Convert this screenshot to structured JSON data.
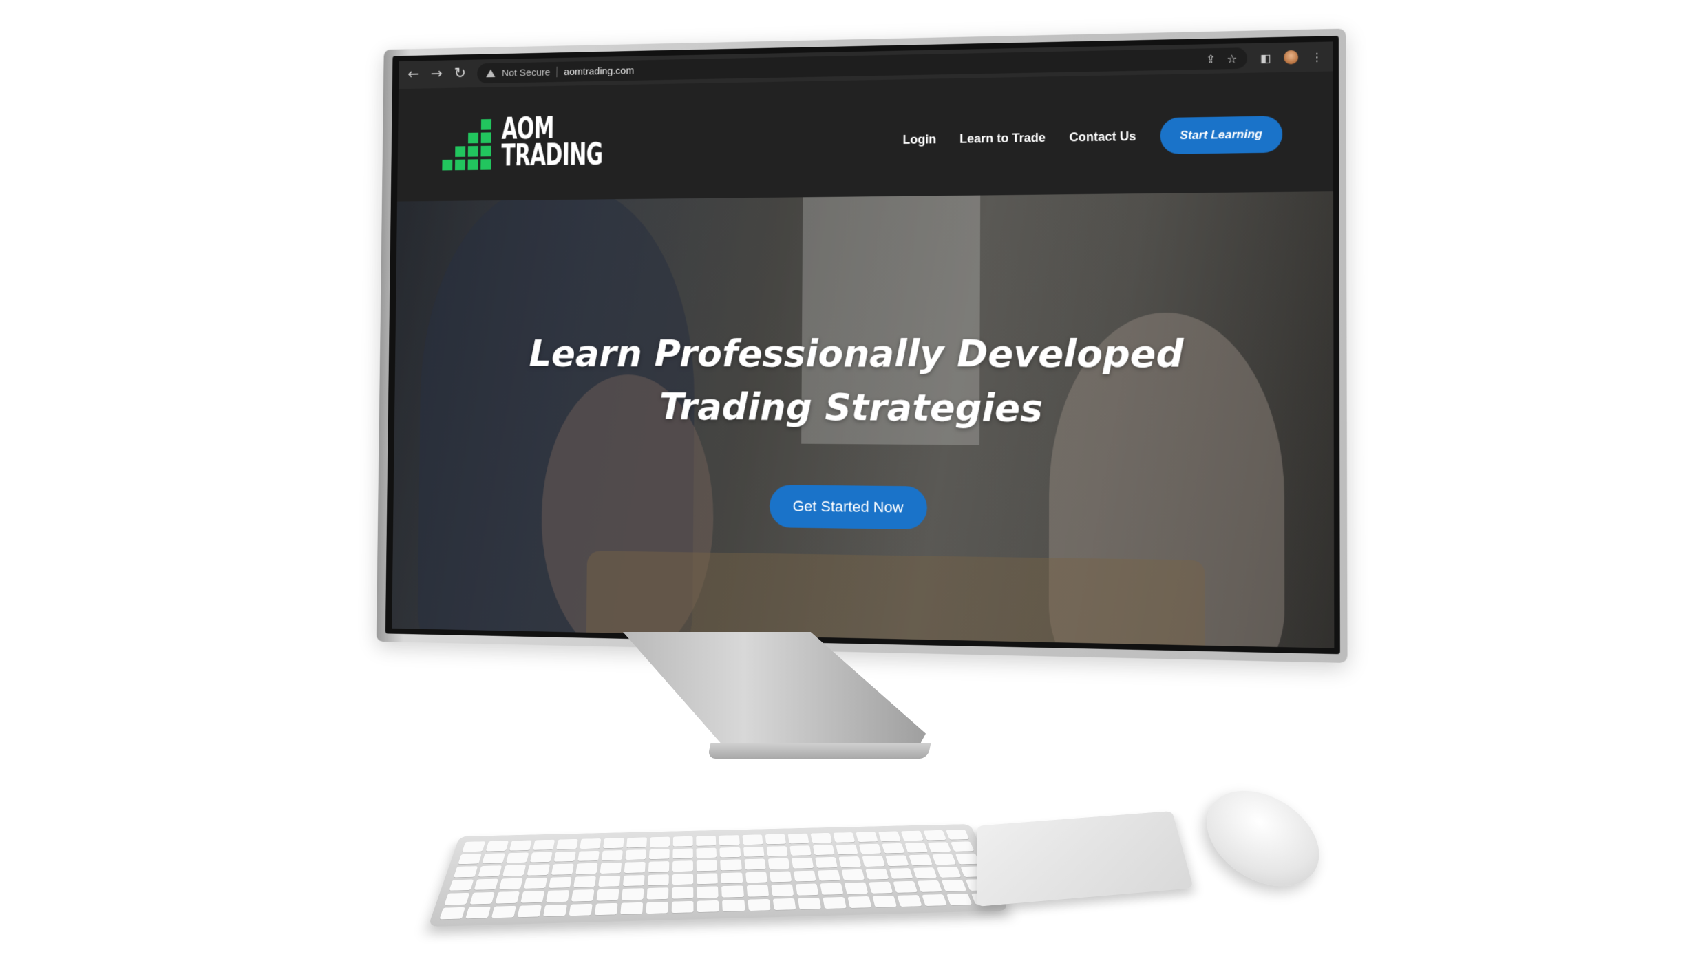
{
  "browser": {
    "security_label": "Not Secure",
    "url": "aomtrading.com",
    "icons": [
      "back-arrow-icon",
      "forward-arrow-icon",
      "reload-icon",
      "warning-icon",
      "share-icon",
      "star-icon",
      "sidebar-icon",
      "profile-avatar",
      "more-menu-icon"
    ]
  },
  "site": {
    "logo": {
      "line1": "AOM",
      "line2": "TRADING",
      "color": "#22c55e"
    },
    "nav": [
      {
        "label": "Login"
      },
      {
        "label": "Learn to Trade"
      },
      {
        "label": "Contact Us"
      }
    ],
    "cta_top": "Start Learning",
    "accent_color": "#1a73c9",
    "header_bg": "#222222"
  },
  "hero": {
    "title_line1": "Learn Professionally Developed",
    "title_line2": "Trading Strategies",
    "cta": "Get Started Now"
  }
}
